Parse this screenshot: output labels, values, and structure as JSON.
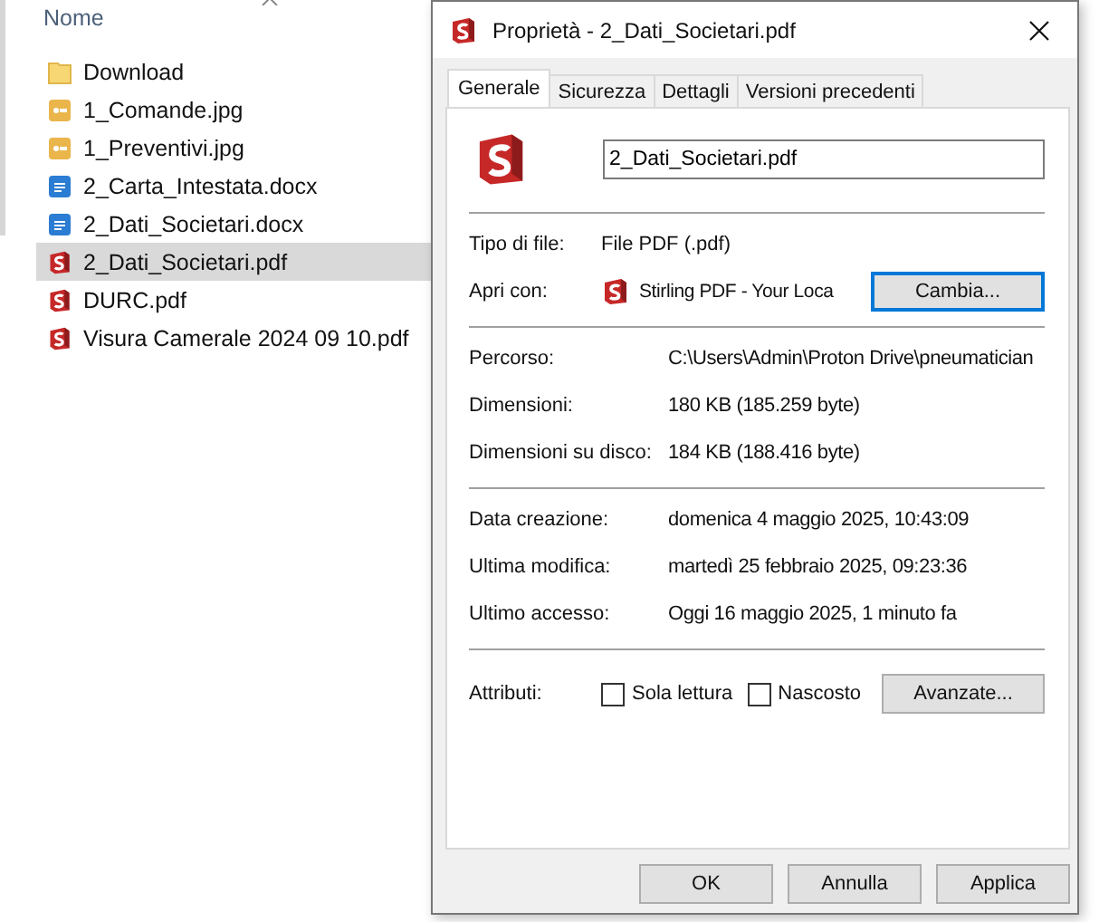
{
  "explorer": {
    "column_header": "Nome",
    "files": [
      {
        "name": "Download",
        "kind": "folder",
        "selected": false
      },
      {
        "name": "1_Comande.jpg",
        "kind": "image",
        "selected": false
      },
      {
        "name": "1_Preventivi.jpg",
        "kind": "image",
        "selected": false
      },
      {
        "name": "2_Carta_Intestata.docx",
        "kind": "document",
        "selected": false
      },
      {
        "name": "2_Dati_Societari.docx",
        "kind": "document",
        "selected": false
      },
      {
        "name": "2_Dati_Societari.pdf",
        "kind": "pdf",
        "selected": true
      },
      {
        "name": "DURC.pdf",
        "kind": "pdf",
        "selected": false
      },
      {
        "name": "Visura Camerale 2024 09 10.pdf",
        "kind": "pdf",
        "selected": false
      }
    ]
  },
  "dialog": {
    "title": "Proprietà - 2_Dati_Societari.pdf",
    "tabs": [
      {
        "label": "Generale",
        "selected": true
      },
      {
        "label": "Sicurezza",
        "selected": false
      },
      {
        "label": "Dettagli",
        "selected": false
      },
      {
        "label": "Versioni precedenti",
        "selected": false
      }
    ],
    "file_name": "2_Dati_Societari.pdf",
    "file_type": {
      "label": "Tipo di file:",
      "value": "File PDF (.pdf)"
    },
    "open_with": {
      "label": "Apri con:",
      "value": "Stirling PDF - Your Loca",
      "button": "Cambia..."
    },
    "location_rows": [
      {
        "label": "Percorso:",
        "value": "C:\\Users\\Admin\\Proton Drive\\pneumatician"
      },
      {
        "label": "Dimensioni:",
        "value": "180 KB (185.259 byte)"
      },
      {
        "label": "Dimensioni su disco:",
        "value": "184 KB (188.416 byte)"
      }
    ],
    "date_rows": [
      {
        "label": "Data creazione:",
        "value": "domenica 4 maggio 2025, 10:43:09"
      },
      {
        "label": "Ultima modifica:",
        "value": "martedì 25 febbraio 2025, 09:23:36"
      },
      {
        "label": "Ultimo accesso:",
        "value": "Oggi 16 maggio 2025, 1 minuto fa"
      }
    ],
    "attributes": {
      "label": "Attributi:",
      "items": [
        {
          "label": "Sola lettura",
          "checked": false
        },
        {
          "label": "Nascosto",
          "checked": false
        }
      ],
      "button": "Avanzate..."
    },
    "buttons": [
      "OK",
      "Annulla",
      "Applica"
    ]
  }
}
